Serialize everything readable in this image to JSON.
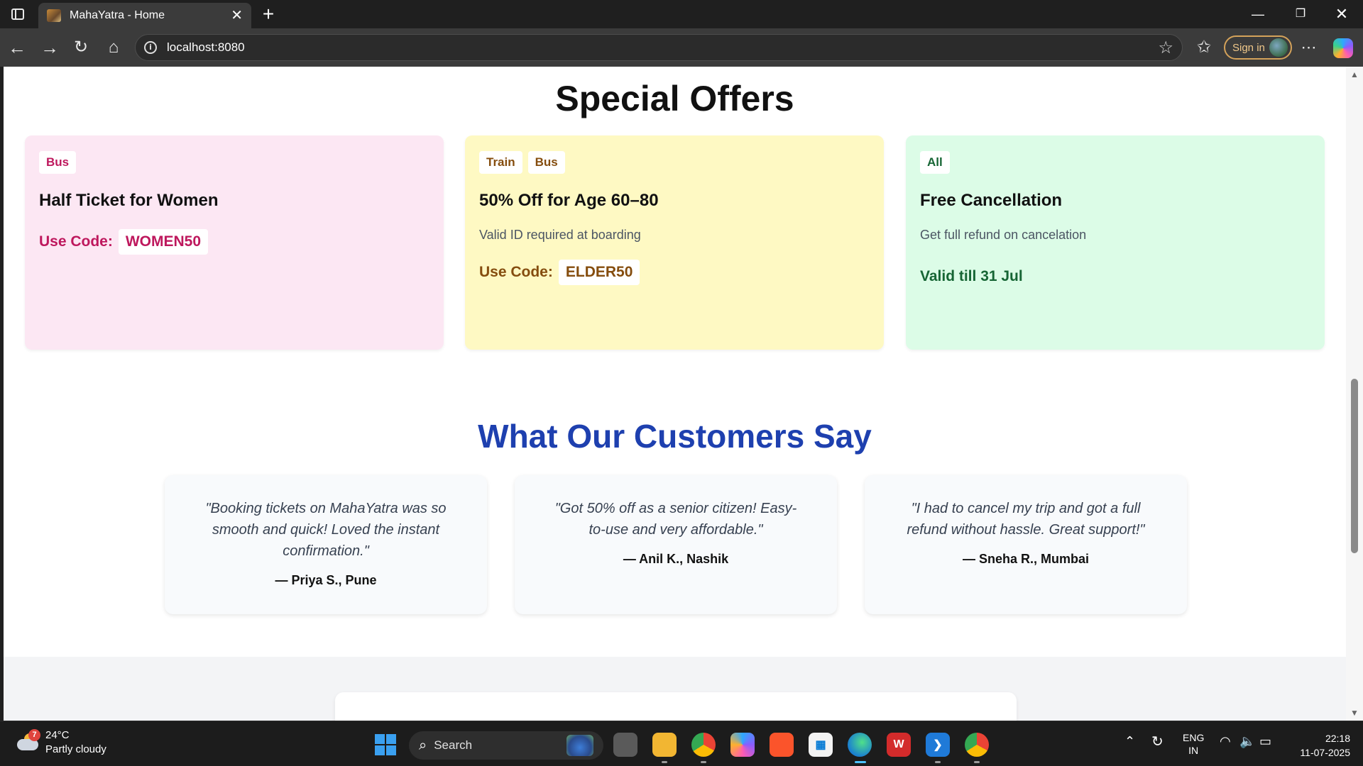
{
  "browser": {
    "tab_title": "MahaYatra - Home",
    "tab_close": "✕",
    "new_tab": "+",
    "address": "localhost:8080",
    "sign_in": "Sign in",
    "icons": [
      "sidebar-icon",
      "back-icon",
      "forward-icon",
      "reload-icon",
      "home-icon",
      "info-icon",
      "star-icon",
      "favorites-icon",
      "more-icon",
      "copilot-icon"
    ]
  },
  "offers": {
    "title": "Special Offers",
    "cards": [
      {
        "tags": [
          "Bus"
        ],
        "title": "Half Ticket for Women",
        "code_label": "Use Code:",
        "code": "WOMEN50",
        "color": "#be185d",
        "background": "#fce7f3"
      },
      {
        "tags": [
          "Train",
          "Bus"
        ],
        "title": "50% Off for Age 60–80",
        "description": "Valid ID required at boarding",
        "code_label": "Use Code:",
        "code": "ELDER50",
        "color": "#854d0e",
        "background": "#fef9c3"
      },
      {
        "tags": [
          "All"
        ],
        "title": "Free Cancellation",
        "description": "Get full refund on cancelation",
        "validity": "Valid till 31 Jul",
        "color": "#166534",
        "background": "#dcfce7"
      }
    ]
  },
  "testimonials": {
    "title": "What Our Customers Say",
    "title_color": "#1e40af",
    "items": [
      {
        "quote": "\"Booking tickets on MahaYatra was so smooth and quick! Loved the instant confirmation.\"",
        "author": "— Priya S., Pune"
      },
      {
        "quote": "\"Got 50% off as a senior citizen! Easy-to-use and very affordable.\"",
        "author": "— Anil K., Nashik"
      },
      {
        "quote": "\"I had to cancel my trip and got a full refund without hassle. Great support!\"",
        "author": "— Sneha R., Mumbai"
      }
    ]
  },
  "taskbar": {
    "weather_temp": "24°C",
    "weather_desc": "Partly cloudy",
    "weather_badge": "7",
    "search_label": "Search",
    "lang_line1": "ENG",
    "lang_line2": "IN",
    "time": "22:18",
    "date": "11-07-2025",
    "apps": [
      "task-view",
      "file-explorer",
      "chrome",
      "copilot",
      "brave",
      "microsoft-store",
      "edge",
      "wps-office",
      "vscode",
      "chrome-canary"
    ]
  }
}
